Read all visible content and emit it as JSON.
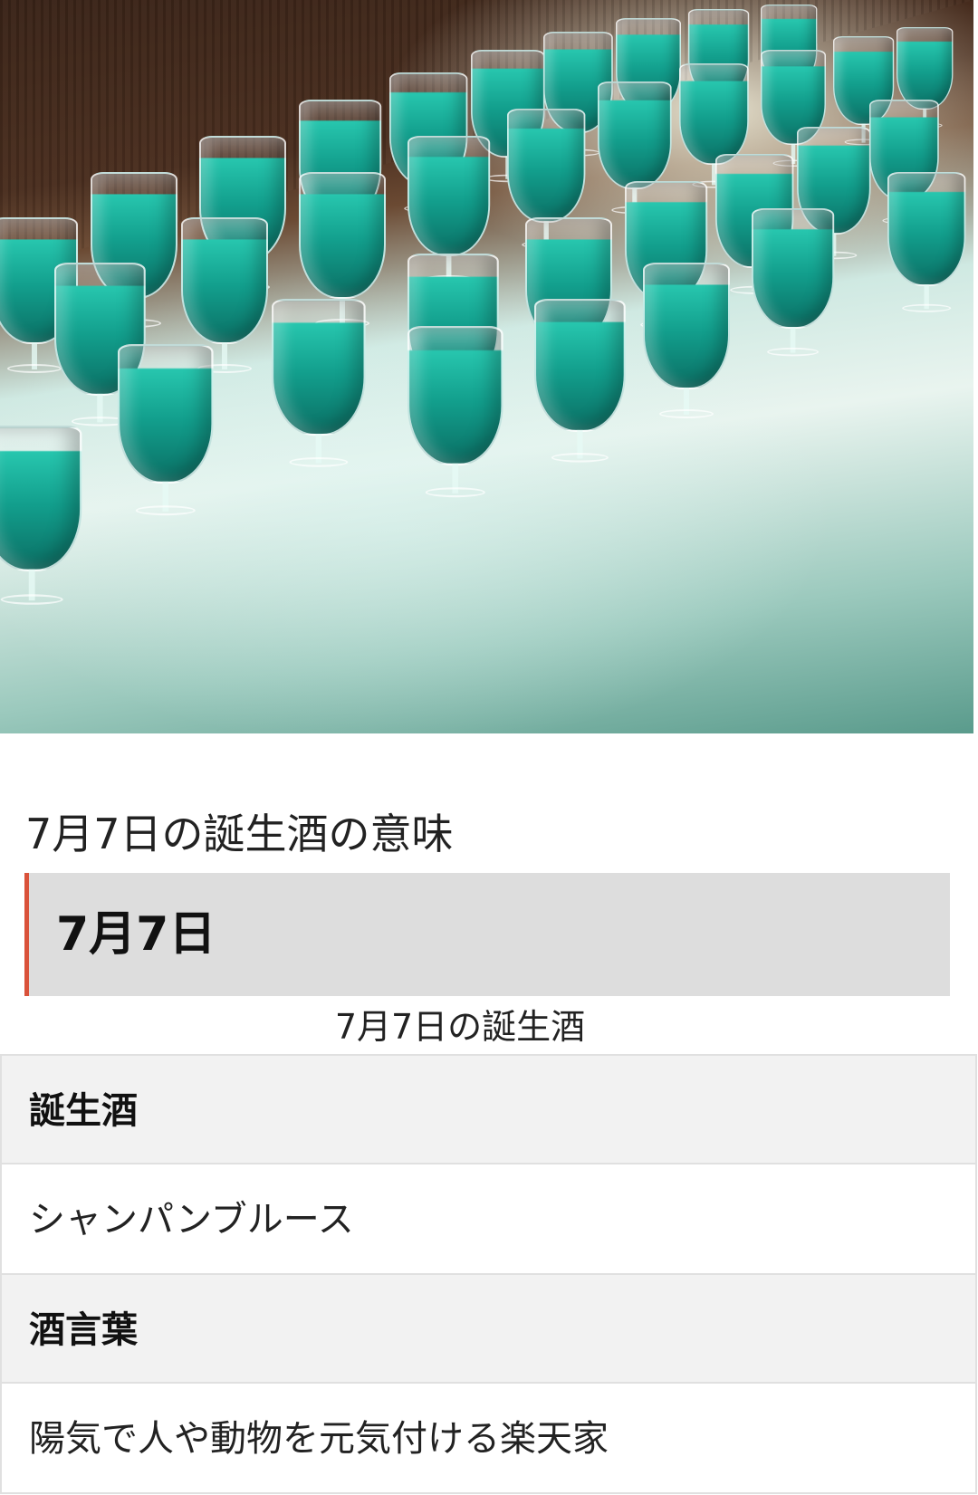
{
  "hero": {
    "image_label": "blue-champagne-glasses-photo"
  },
  "article": {
    "section_title": "7月7日の誕生酒の意味",
    "date_heading": "7月7日",
    "table_caption": "7月7日の誕生酒"
  },
  "table": {
    "rows": [
      {
        "header": "誕生酒",
        "value": "シャンパンブルース"
      },
      {
        "header": "酒言葉",
        "value": "陽気で人や動物を元気付ける楽天家"
      }
    ]
  },
  "colors": {
    "accent_border": "#d9523a",
    "heading_bg": "#dddddd",
    "table_header_bg": "#f2f2f2",
    "table_border": "#e0e0e0",
    "drink_teal": "#27c6ae"
  }
}
